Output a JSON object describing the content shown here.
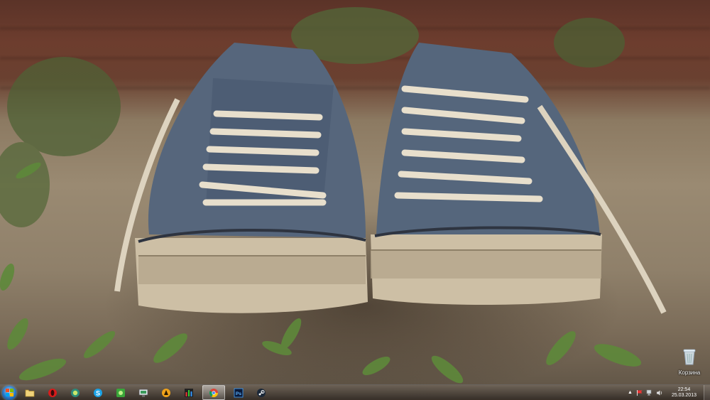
{
  "desktop": {
    "icons": [
      {
        "name": "recycle-bin",
        "label": "Корзина"
      }
    ]
  },
  "taskbar": {
    "start": {
      "icon": "windows-logo-icon"
    },
    "pinned": [
      {
        "app": "Windows Explorer",
        "icon": "folder-icon",
        "active": false
      },
      {
        "app": "Opera",
        "icon": "opera-icon",
        "active": false
      },
      {
        "app": "Unknown app",
        "icon": "green-circle-app-icon",
        "active": false
      },
      {
        "app": "Skype",
        "icon": "skype-icon",
        "active": false
      },
      {
        "app": "Unknown app",
        "icon": "green-square-app-icon",
        "active": false
      },
      {
        "app": "Unknown app",
        "icon": "monitor-app-icon",
        "active": false
      },
      {
        "app": "Unknown app",
        "icon": "orange-circle-app-icon",
        "active": false
      },
      {
        "app": "Unknown app",
        "icon": "equalizer-app-icon",
        "active": false
      },
      {
        "app": "Google Chrome",
        "icon": "chrome-icon",
        "active": true
      },
      {
        "app": "Adobe Photoshop",
        "icon": "photoshop-icon",
        "active": false
      },
      {
        "app": "Steam",
        "icon": "steam-icon",
        "active": false
      }
    ],
    "tray": {
      "expand_icon": "tray-expand-arrow-icon",
      "icons": [
        "flag-icon",
        "network-icon",
        "volume-icon"
      ],
      "time": "22:54",
      "date": "25.03.2013"
    }
  },
  "colors": {
    "taskbar_bg": "#3a322c",
    "start_orb": "#2a78c8",
    "wallpaper_brick": "#6d3d2e",
    "wallpaper_ground": "#9a8a72",
    "shoe_canvas": "#5b6a80",
    "shoe_rubber": "#cfc0a6"
  }
}
